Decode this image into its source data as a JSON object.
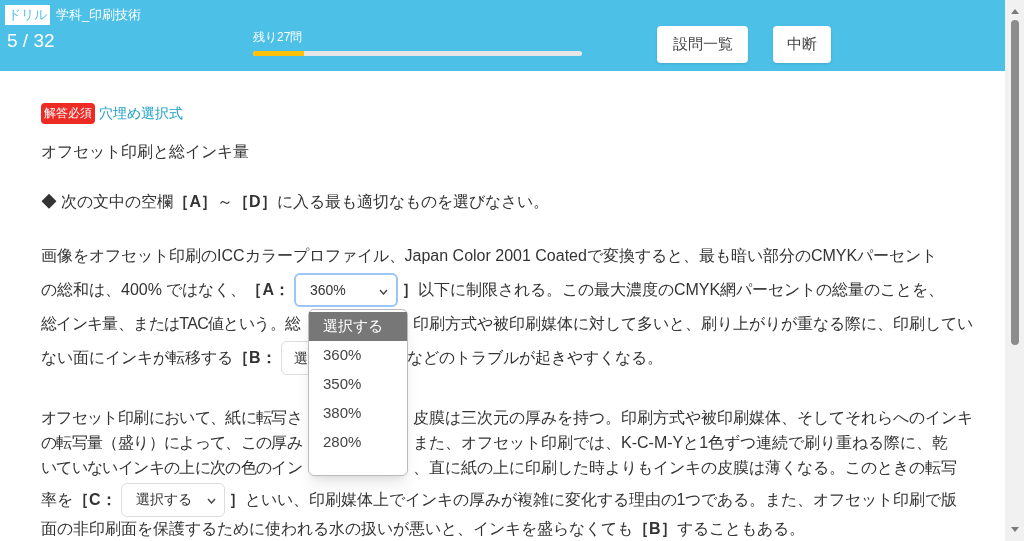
{
  "header": {
    "badge": "ドリル",
    "subject": "学科_印刷技術",
    "counter": "5 / 32",
    "progress": {
      "label": "残り27問",
      "level": 0.156
    },
    "buttons": [
      "設問一覧",
      "中断"
    ]
  },
  "question": {
    "required_badge": "解答必須",
    "type": "穴埋め選択式",
    "title": "オフセット印刷と総インキ量",
    "instruction": "◆ 次の文中の空欄**［A］**～**［D］**に入る最も適切なものを選びなさい。",
    "paragraphs": [
      [
        [
          {
            "kind": "text",
            "text": "画像をオフセット印刷のICCカラープロファイル、Japan Color 2001 Coatedで変換すると、最も暗い部分のCMYKパーセント"
          }
        ],
        [
          {
            "kind": "text",
            "text": "の総和は、400% ではなく、"
          },
          {
            "kind": "bold",
            "text": "［A："
          },
          {
            "kind": "select",
            "value": "360%",
            "focused": true
          },
          {
            "kind": "bold",
            "text": "］"
          },
          {
            "kind": "text",
            "text": "以下に制限される。この最大濃度のCMYK網パーセントの総量のことを、"
          }
        ],
        [
          {
            "kind": "text",
            "text": "総インキ量、またはTAC値という。総"
          },
          {
            "kind": "covered"
          },
          {
            "kind": "text",
            "text": "印刷方式や被印刷媒体に対して多いと、刷り上がりが重なる際に、印刷してい"
          }
        ],
        [
          {
            "kind": "text",
            "text": "ない面にインキが転移する"
          },
          {
            "kind": "bold",
            "text": "［B："
          },
          {
            "kind": "select",
            "value": "選",
            "focused": false,
            "covered": true
          },
          {
            "kind": "text",
            "text": "などのトラブルが起きやすくなる。"
          }
        ]
      ],
      [
        [
          {
            "kind": "text",
            "text": "オフセット印刷において、紙に転写さ"
          },
          {
            "kind": "covered"
          },
          {
            "kind": "text",
            "text": "皮膜は三次元の厚みを持つ。印刷方式や被印刷媒体、そしてそれらへのインキ"
          }
        ],
        [
          {
            "kind": "text",
            "text": "の転写量（盛り）によって、この厚み"
          },
          {
            "kind": "covered"
          },
          {
            "kind": "text",
            "text": "また、オフセット印刷では、K-C-M-Yと1色ずつ連続で刷り重ねる際に、乾"
          }
        ],
        [
          {
            "kind": "text",
            "text": "いていないインキの上に次の色のイン"
          },
          {
            "kind": "covered"
          },
          {
            "kind": "text",
            "text": "、直に紙の上に印刷した時よりもインキの皮膜は薄くなる。このときの転写"
          }
        ],
        [
          {
            "kind": "text",
            "text": "率を"
          },
          {
            "kind": "bold",
            "text": "［C："
          },
          {
            "kind": "select",
            "value": "選択する",
            "focused": false
          },
          {
            "kind": "bold",
            "text": "］"
          },
          {
            "kind": "text",
            "text": "といい、印刷媒体上でインキの厚みが複雑に変化する理由の1つである。また、オフセット印刷で版"
          }
        ],
        [
          {
            "kind": "text",
            "text": "面の非印刷面を保護するために使われる水の扱いが悪いと、インキを盛らなくても"
          },
          {
            "kind": "bold",
            "text": "［B］"
          },
          {
            "kind": "text",
            "text": "することもある。"
          }
        ]
      ]
    ],
    "dropdown": [
      {
        "label": "選択する",
        "selected": true
      },
      {
        "label": "360%",
        "selected": false
      },
      {
        "label": "350%",
        "selected": false
      },
      {
        "label": "380%",
        "selected": false
      },
      {
        "label": "280%",
        "selected": false
      }
    ]
  }
}
